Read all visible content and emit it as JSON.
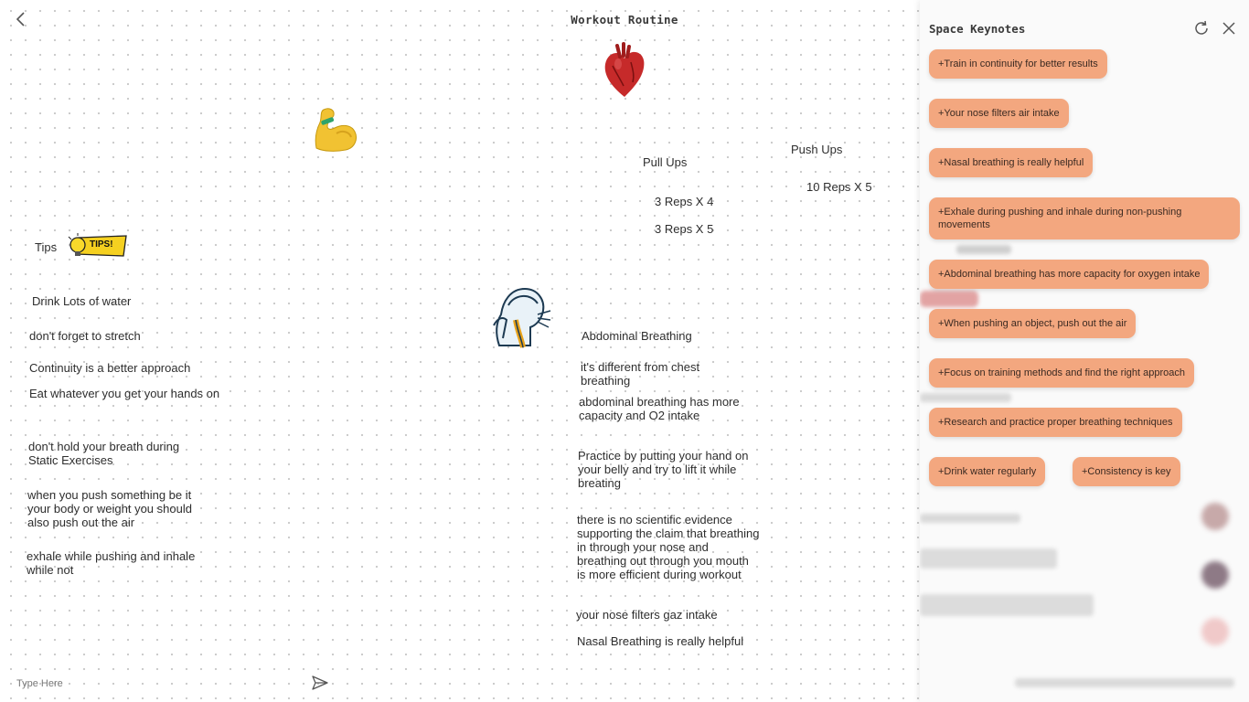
{
  "board": {
    "title": "Workout Routine",
    "input_placeholder": "Type Here"
  },
  "notes": {
    "tips_label": "Tips",
    "tips_badge": "TIPS!",
    "tips": [
      "Drink Lots of water",
      "don't forget to stretch",
      "Continuity is a better approach",
      "Eat whatever you get your hands on",
      "don't hold your breath during Static Exercises",
      "when you push something be it your body or weight you should also push out the air",
      "exhale while pushing and inhale while not"
    ],
    "pull_ups": {
      "title": "Pull Ups",
      "rep_1": "3 Reps X 4",
      "rep_2": "3 Reps X 5"
    },
    "push_ups": {
      "title": "Push Ups",
      "rep_1": "10 Reps X 5"
    },
    "breathing": {
      "title": "Abdominal Breathing",
      "items": [
        "it's different from chest breathing",
        "abdominal breathing has more capacity and O2 intake",
        "Practice by putting your hand on your belly and try to lift it while breating",
        "there is no scientific evidence supporting the claim that breathing in through your nose and breathing out through you mouth is more efficient during workout",
        "your nose filters gaz intake",
        "Nasal Breathing is really helpful"
      ]
    }
  },
  "panel": {
    "title": "Space Keynotes",
    "chips": [
      "+Train in continuity for better results",
      "+Your nose filters air intake",
      "+Nasal breathing is really helpful",
      "+Exhale during pushing and inhale during non-pushing movements",
      "+Abdominal breathing has more capacity for oxygen intake",
      "+When pushing an object, push out the air",
      "+Focus on training methods and find the right approach",
      "+Research and practice proper breathing techniques",
      "+Drink water regularly",
      "+Consistency is key"
    ]
  },
  "colors": {
    "chip": "#f3a77f",
    "canvas_dot": "#c9c9c9",
    "panel_bg": "#fafafa"
  },
  "icons": [
    "back-arrow-icon",
    "heart-sticker",
    "flexed-biceps-sticker",
    "tips-lightbulb-sticker",
    "breathing-person-sticker",
    "send-icon",
    "refresh-icon",
    "close-icon"
  ]
}
